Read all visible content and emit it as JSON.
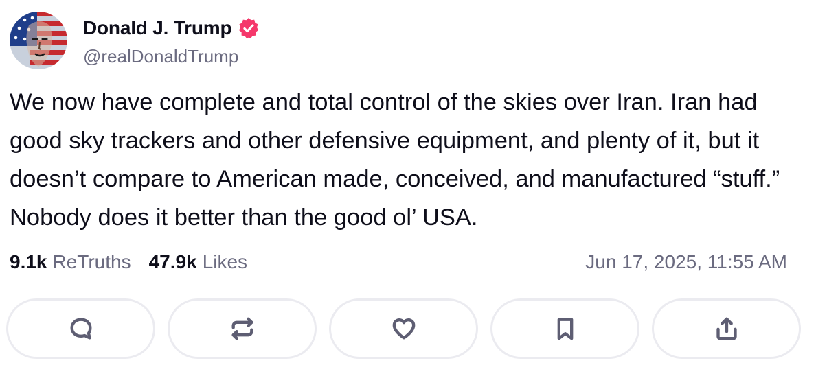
{
  "post": {
    "author": {
      "display_name": "Donald J. Trump",
      "handle": "@realDonaldTrump",
      "verified": true,
      "verified_color": "#f5386b"
    },
    "text": "We now have complete and total control of the skies over Iran. Iran had good sky trackers and other defensive equipment, and plenty of it, but it doesn’t compare to American made, conceived, and manufactured “stuff.”  Nobody does it better than the good ol’ USA.",
    "stats": {
      "retruths_count": "9.1k",
      "retruths_label": "ReTruths",
      "likes_count": "47.9k",
      "likes_label": "Likes"
    },
    "timestamp": "Jun 17, 2025, 11:55 AM"
  },
  "actions": [
    {
      "name": "reply",
      "icon": "comment-bubble-icon"
    },
    {
      "name": "retruth",
      "icon": "repost-arrows-icon"
    },
    {
      "name": "like",
      "icon": "heart-icon"
    },
    {
      "name": "bookmark",
      "icon": "bookmark-icon"
    },
    {
      "name": "share",
      "icon": "share-upload-icon"
    }
  ],
  "colors": {
    "text_primary": "#0e0e1a",
    "text_secondary": "#6b6b80",
    "button_border": "#ebebf0",
    "icon": "#5e5e73"
  }
}
